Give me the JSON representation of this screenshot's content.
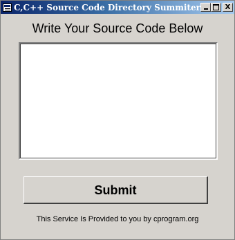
{
  "window": {
    "title": "C,C++ Source Code Directory Summiter",
    "minimize_symbol": "_",
    "maximize_symbol": "□",
    "close_symbol": "X"
  },
  "main": {
    "heading": "Write Your Source Code Below",
    "code_value": "",
    "submit_label": "Submit",
    "footer_text": "This Service Is Provided to you by cprogram.org"
  },
  "colors": {
    "face": "#d6d3ce",
    "titlebar_start": "#0a246a",
    "titlebar_end": "#a6caf0"
  }
}
